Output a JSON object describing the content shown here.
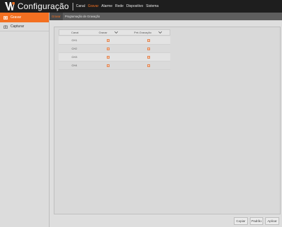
{
  "app": {
    "title": "Configuração"
  },
  "menu": {
    "items": [
      {
        "label": "Canal",
        "active": false
      },
      {
        "label": "Gravar",
        "active": true
      },
      {
        "label": "Alarme",
        "active": false
      },
      {
        "label": "Rede",
        "active": false
      },
      {
        "label": "Dispositivo",
        "active": false
      },
      {
        "label": "Sistema",
        "active": false
      }
    ]
  },
  "sidebar": {
    "items": [
      {
        "label": "Gravar",
        "icon": "record-icon",
        "active": true
      },
      {
        "label": "Capturar",
        "icon": "camera-icon",
        "active": false
      }
    ]
  },
  "subtabs": {
    "items": [
      {
        "label": "Gravar",
        "active": true
      },
      {
        "label": "Programação de Gravação",
        "active": false
      }
    ]
  },
  "table": {
    "headers": {
      "canal": "Canal",
      "gravar": "Gravar",
      "pre": "Pré-Gravação"
    },
    "rows": [
      {
        "canal": "CH1",
        "gravar": true,
        "pre": true
      },
      {
        "canal": "CH2",
        "gravar": true,
        "pre": true
      },
      {
        "canal": "CH3",
        "gravar": true,
        "pre": true
      },
      {
        "canal": "CH4",
        "gravar": true,
        "pre": true
      }
    ]
  },
  "footer": {
    "copiar": "Copiar",
    "padrao": "Padrão",
    "aplicar": "Aplicar"
  },
  "colors": {
    "accent": "#f37021",
    "topbar": "#1e1e1e",
    "subtabs": "#5e5e5e"
  }
}
